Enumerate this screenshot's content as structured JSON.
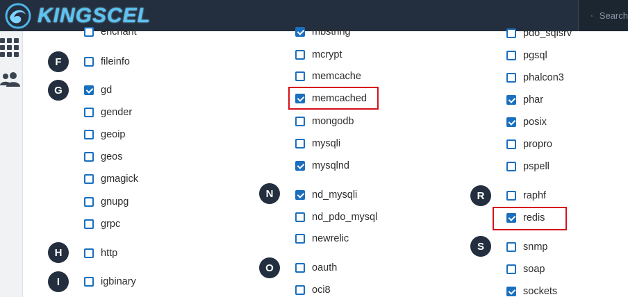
{
  "header": {
    "brand": "KINGSCEL",
    "search_placeholder": "Search"
  },
  "sidebar": {
    "icons": [
      "grid-icon",
      "users-icon"
    ]
  },
  "letters": [
    "F",
    "G",
    "H",
    "I",
    "N",
    "O",
    "R",
    "S"
  ],
  "columns": {
    "col1": [
      {
        "name": "enchant",
        "checked": false
      },
      {
        "name": "fileinfo",
        "checked": false
      },
      {
        "name": "gd",
        "checked": true
      },
      {
        "name": "gender",
        "checked": false
      },
      {
        "name": "geoip",
        "checked": false
      },
      {
        "name": "geos",
        "checked": false
      },
      {
        "name": "gmagick",
        "checked": false
      },
      {
        "name": "gnupg",
        "checked": false
      },
      {
        "name": "grpc",
        "checked": false
      },
      {
        "name": "http",
        "checked": false
      },
      {
        "name": "igbinary",
        "checked": false
      }
    ],
    "col2": [
      {
        "name": "mbstring",
        "checked": true
      },
      {
        "name": "mcrypt",
        "checked": false
      },
      {
        "name": "memcache",
        "checked": false
      },
      {
        "name": "memcached",
        "checked": true,
        "highlighted": true
      },
      {
        "name": "mongodb",
        "checked": false
      },
      {
        "name": "mysqli",
        "checked": false
      },
      {
        "name": "mysqlnd",
        "checked": true
      },
      {
        "name": "nd_mysqli",
        "checked": true
      },
      {
        "name": "nd_pdo_mysql",
        "checked": false
      },
      {
        "name": "newrelic",
        "checked": false
      },
      {
        "name": "oauth",
        "checked": false
      },
      {
        "name": "oci8",
        "checked": false
      }
    ],
    "col3": [
      {
        "name": "pdo_sqlsrv",
        "checked": false
      },
      {
        "name": "pgsql",
        "checked": false
      },
      {
        "name": "phalcon3",
        "checked": false
      },
      {
        "name": "phar",
        "checked": true
      },
      {
        "name": "posix",
        "checked": true
      },
      {
        "name": "propro",
        "checked": false
      },
      {
        "name": "pspell",
        "checked": false
      },
      {
        "name": "raphf",
        "checked": false
      },
      {
        "name": "redis",
        "checked": true,
        "highlighted": true
      },
      {
        "name": "snmp",
        "checked": false
      },
      {
        "name": "soap",
        "checked": false
      },
      {
        "name": "sockets",
        "checked": true
      }
    ]
  }
}
